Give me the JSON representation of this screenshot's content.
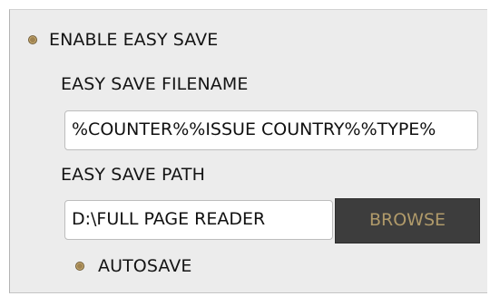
{
  "options": {
    "enable_easy_save": {
      "label": "ENABLE EASY SAVE",
      "selected": true
    },
    "autosave": {
      "label": "AUTOSAVE",
      "selected": true
    }
  },
  "filename": {
    "label": "EASY SAVE FILENAME",
    "value": "%COUNTER%%ISSUE COUNTRY%%TYPE%"
  },
  "path": {
    "label": "EASY SAVE PATH",
    "value": "D:\\FULL PAGE READER",
    "browse_label": "BROWSE"
  },
  "colors": {
    "radio_fill": "#a08350",
    "panel_background": "#ececec",
    "button_background": "#3d3d3d",
    "button_text": "#b09a6a"
  },
  "icons": {
    "radio": "radio-selected-icon"
  }
}
